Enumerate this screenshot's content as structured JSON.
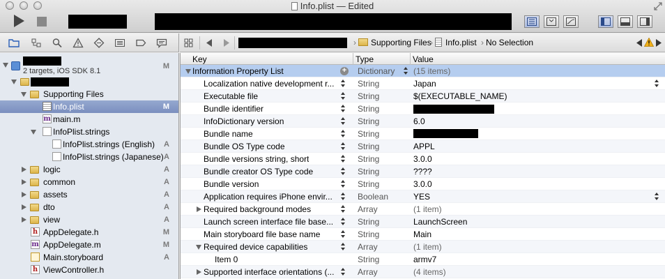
{
  "window": {
    "title": "Info.plist — Edited"
  },
  "jump_bar": {
    "crumbs": [
      "Supporting Files",
      "Info.plist",
      "No Selection"
    ]
  },
  "navigator": {
    "project": {
      "subtitle": "2 targets, iOS SDK 8.1",
      "badge": "M"
    },
    "items": [
      {
        "label": "Supporting Files",
        "badge": ""
      },
      {
        "label": "Info.plist",
        "badge": "M"
      },
      {
        "label": "main.m",
        "badge": ""
      },
      {
        "label": "InfoPlist.strings",
        "badge": ""
      },
      {
        "label": "InfoPlist.strings (English)",
        "badge": "A"
      },
      {
        "label": "InfoPlist.strings (Japanese)",
        "badge": "A"
      },
      {
        "label": "logic",
        "badge": "A"
      },
      {
        "label": "common",
        "badge": "A"
      },
      {
        "label": "assets",
        "badge": "A"
      },
      {
        "label": "dto",
        "badge": "A"
      },
      {
        "label": "view",
        "badge": "A"
      },
      {
        "label": "AppDelegate.h",
        "badge": "M"
      },
      {
        "label": "AppDelegate.m",
        "badge": "M"
      },
      {
        "label": "Main.storyboard",
        "badge": "A"
      },
      {
        "label": "ViewController.h",
        "badge": ""
      }
    ]
  },
  "plist": {
    "columns": {
      "key": "Key",
      "type": "Type",
      "value": "Value"
    },
    "rows": [
      {
        "key": "Information Property List",
        "type": "Dictionary",
        "value": "(15 items)"
      },
      {
        "key": "Localization native development r...",
        "type": "String",
        "value": "Japan"
      },
      {
        "key": "Executable file",
        "type": "String",
        "value": "$(EXECUTABLE_NAME)"
      },
      {
        "key": "Bundle identifier",
        "type": "String",
        "value": ""
      },
      {
        "key": "InfoDictionary version",
        "type": "String",
        "value": "6.0"
      },
      {
        "key": "Bundle name",
        "type": "String",
        "value": ""
      },
      {
        "key": "Bundle OS Type code",
        "type": "String",
        "value": "APPL"
      },
      {
        "key": "Bundle versions string, short",
        "type": "String",
        "value": "3.0.0"
      },
      {
        "key": "Bundle creator OS Type code",
        "type": "String",
        "value": "????"
      },
      {
        "key": "Bundle version",
        "type": "String",
        "value": "3.0.0"
      },
      {
        "key": "Application requires iPhone envir...",
        "type": "Boolean",
        "value": "YES"
      },
      {
        "key": "Required background modes",
        "type": "Array",
        "value": "(1 item)"
      },
      {
        "key": "Launch screen interface file base...",
        "type": "String",
        "value": "LaunchScreen"
      },
      {
        "key": "Main storyboard file base name",
        "type": "String",
        "value": "Main"
      },
      {
        "key": "Required device capabilities",
        "type": "Array",
        "value": "(1 item)"
      },
      {
        "key": "Item 0",
        "type": "String",
        "value": "armv7"
      },
      {
        "key": "Supported interface orientations (...",
        "type": "Array",
        "value": "(4 items)"
      }
    ]
  }
}
